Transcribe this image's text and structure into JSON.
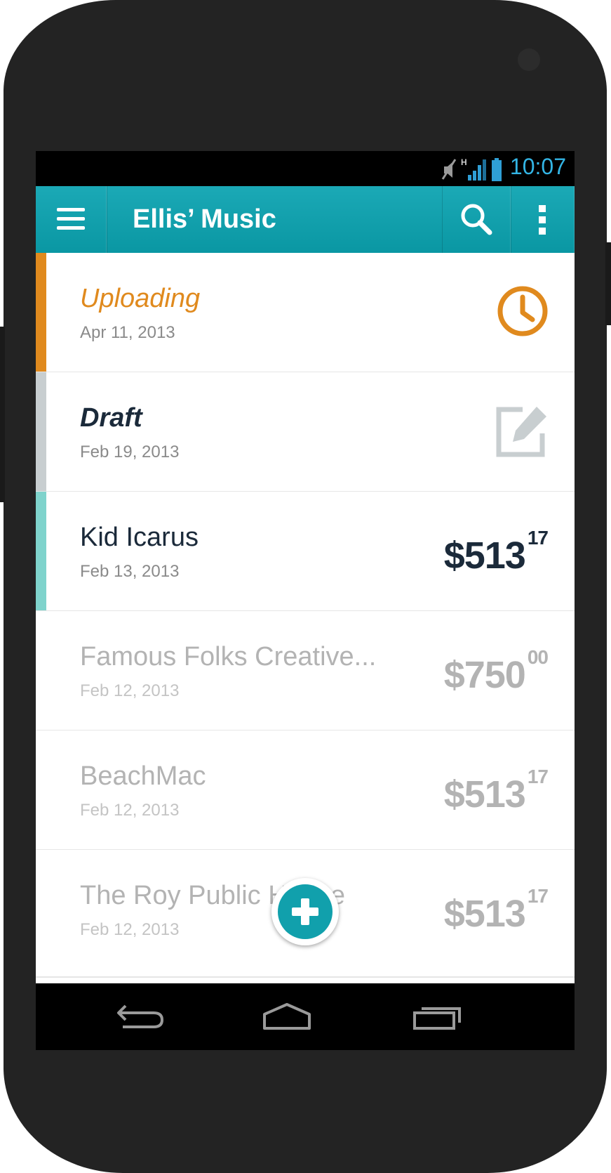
{
  "status_bar": {
    "time": "10:07",
    "network_label": "H",
    "icons": [
      "mute-icon",
      "signal-icon",
      "battery-icon"
    ]
  },
  "action_bar": {
    "title": "Ellis’ Music",
    "icons": [
      "menu-icon",
      "search-icon",
      "overflow-menu-icon"
    ],
    "color": "#0f9fab"
  },
  "list": {
    "items": [
      {
        "title": "Uploading",
        "date": "Apr 11, 2013",
        "status": "uploading",
        "icon": "clock-icon",
        "accent": "#e08a1e"
      },
      {
        "title": "Draft",
        "date": "Feb 19, 2013",
        "status": "draft",
        "icon": "edit-icon",
        "accent": "#c8ced0"
      },
      {
        "title": "Kid Icarus",
        "date": "Feb 13, 2013",
        "amount_main": "$513",
        "amount_cents": "17",
        "accent": "#7fd3cc"
      },
      {
        "title": "Famous Folks Creative...",
        "date": "Feb 12, 2013",
        "amount_main": "$750",
        "amount_cents": "00"
      },
      {
        "title": "BeachMac",
        "date": "Feb 12, 2013",
        "amount_main": "$513",
        "amount_cents": "17"
      },
      {
        "title": "The Roy Public House",
        "date": "Feb 12, 2013",
        "amount_main": "$513",
        "amount_cents": "17"
      }
    ]
  },
  "fab": {
    "icon": "plus-icon"
  },
  "nav_bar": {
    "icons": [
      "back-icon",
      "home-icon",
      "recent-apps-icon"
    ]
  }
}
